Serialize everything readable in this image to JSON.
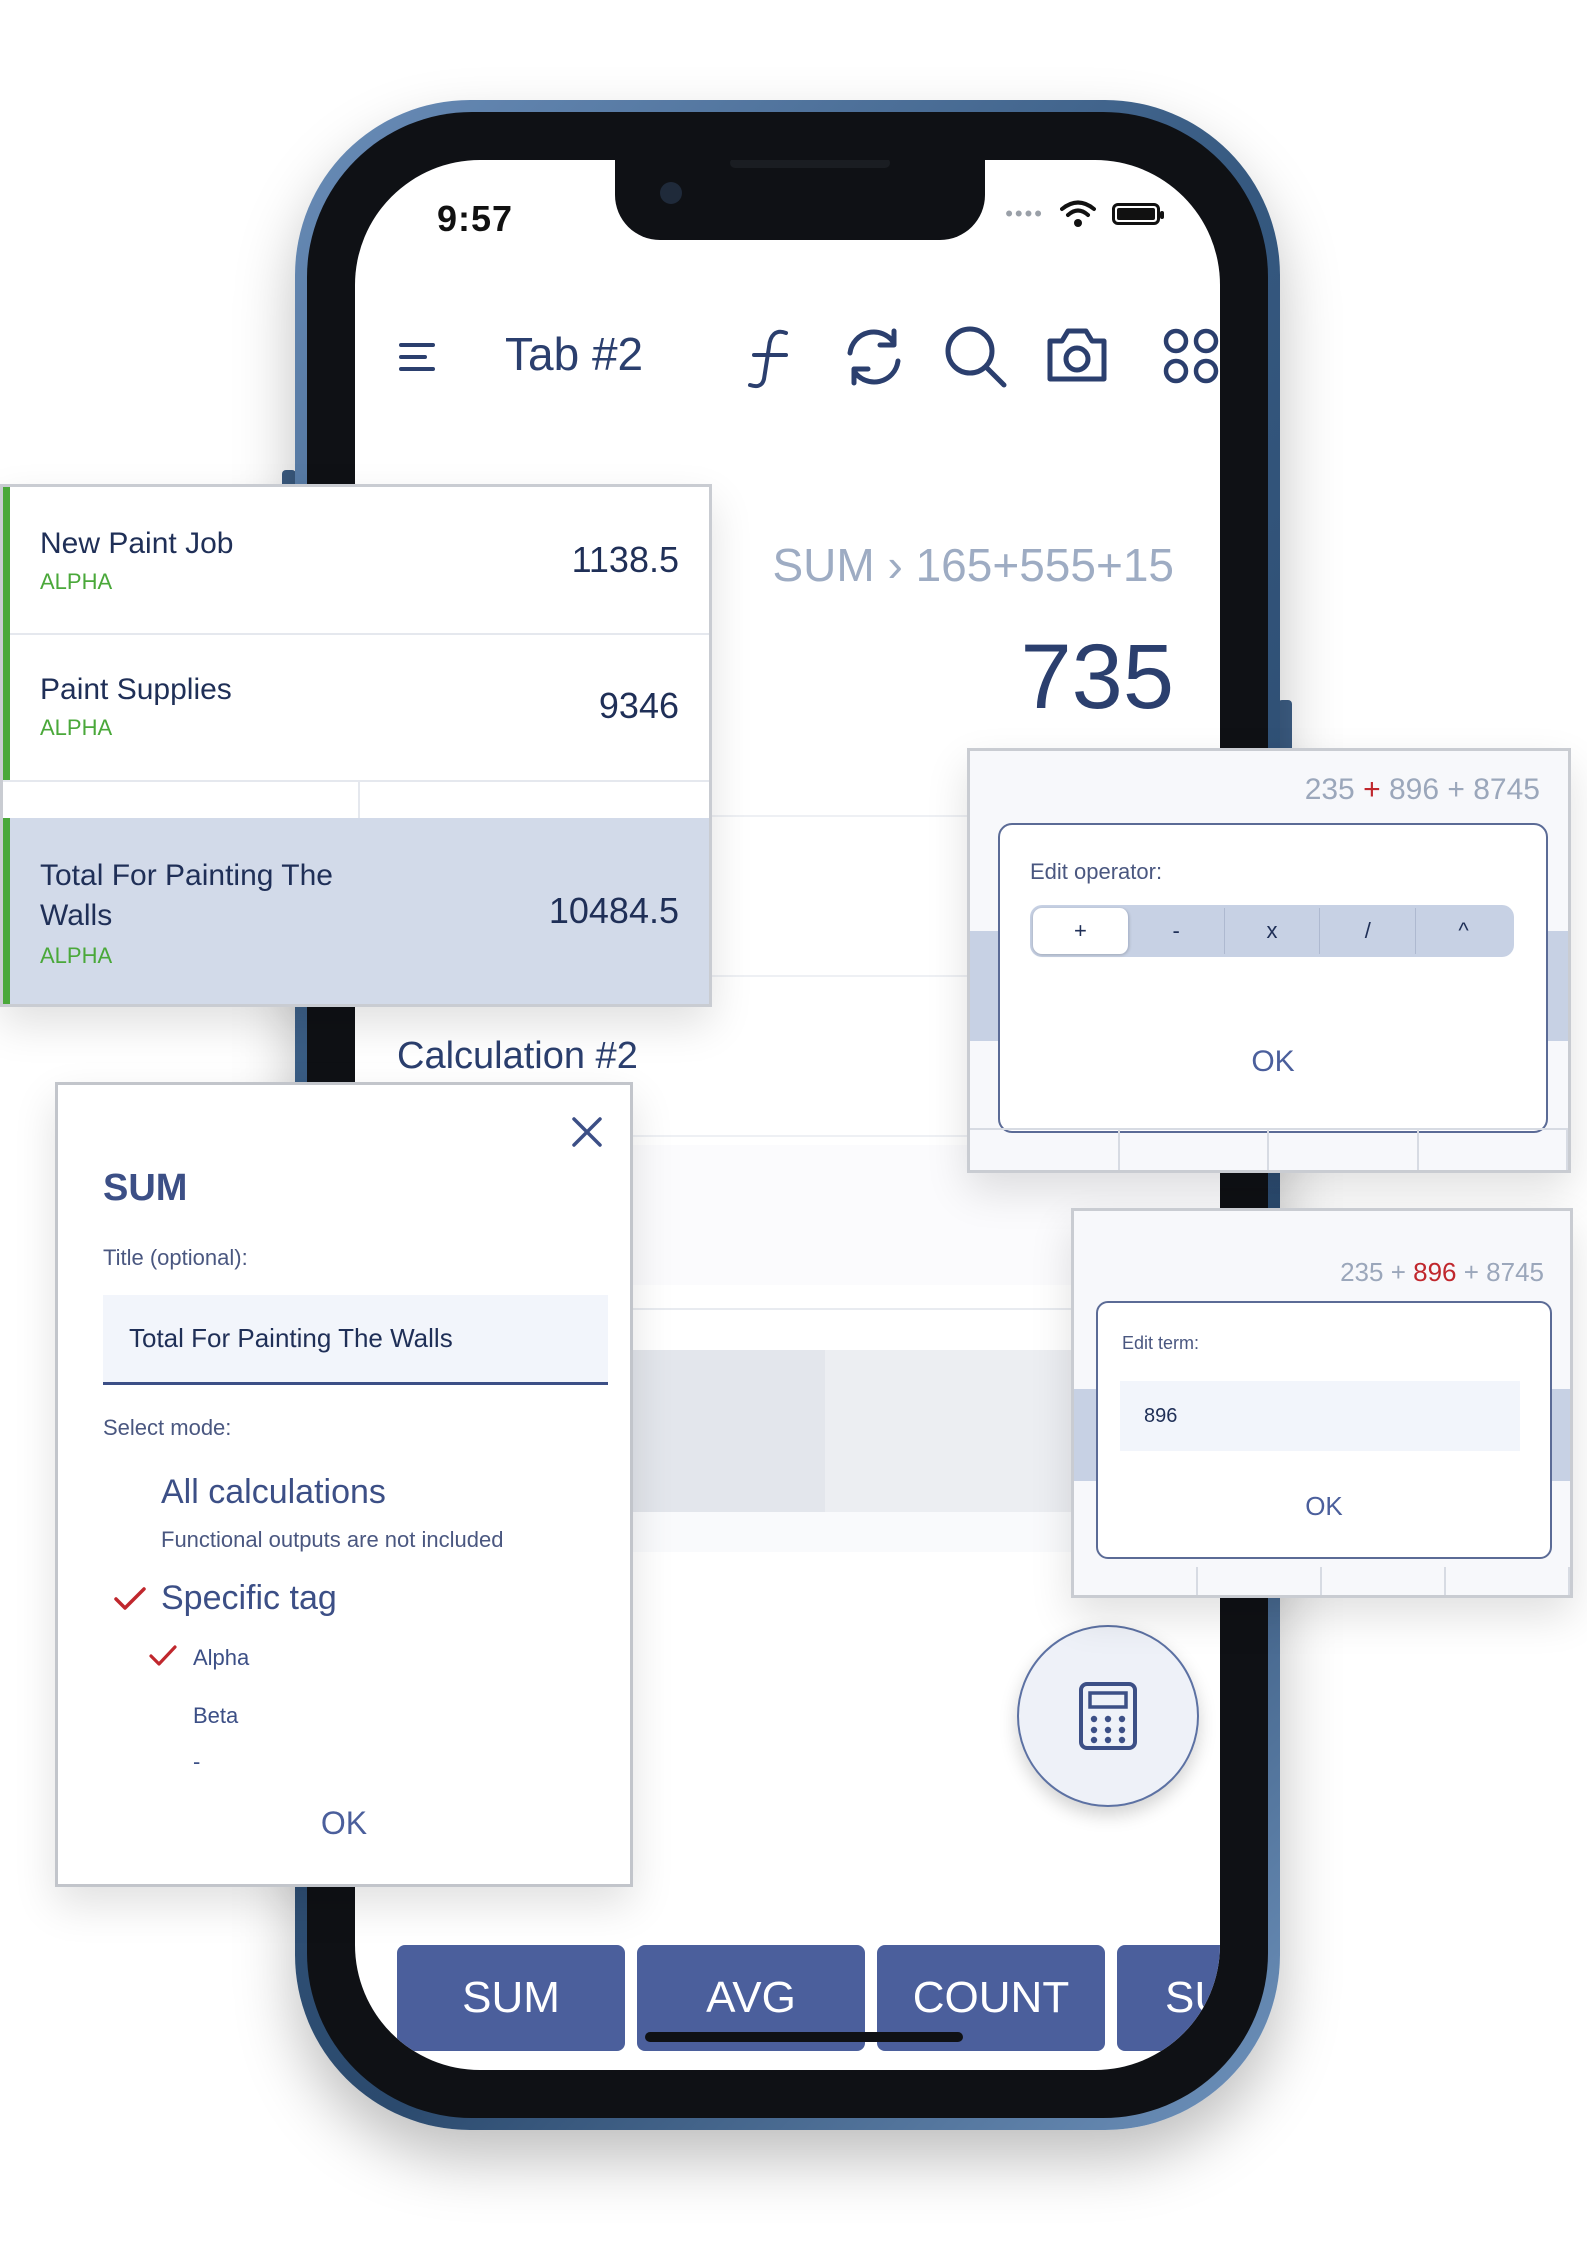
{
  "status": {
    "time": "9:57"
  },
  "toolbar": {
    "tab_title": "Tab #2"
  },
  "calculator": {
    "expression": "SUM › 165+555+15",
    "result": "735",
    "section_title": "Calculation #2"
  },
  "bottom_bar": {
    "sum": "SUM",
    "avg": "AVG",
    "count": "COUNT",
    "sum_cut": "SUN"
  },
  "results_list": [
    {
      "name": "New Paint Job",
      "tag": "ALPHA",
      "value": "1138.5"
    },
    {
      "name": "Paint Supplies",
      "tag": "ALPHA",
      "value": "9346"
    },
    {
      "name": "Total For Painting The Walls",
      "tag": "ALPHA",
      "value": "10484.5"
    }
  ],
  "operator_dialog": {
    "expr_a": "235",
    "expr_op1": "+",
    "expr_b": "896",
    "expr_op2": "+",
    "expr_c": "8745",
    "label": "Edit operator:",
    "options": [
      "+",
      "-",
      "x",
      "/",
      "^"
    ],
    "selected": "+",
    "ok": "OK"
  },
  "term_dialog": {
    "expr_a": "235",
    "expr_op1": "+",
    "expr_b": "896",
    "expr_op2": "+",
    "expr_c": "8745",
    "label": "Edit term:",
    "value": "896",
    "ok": "OK"
  },
  "sum_dialog": {
    "title": "SUM",
    "title_label": "Title (optional):",
    "title_value": "Total For Painting The Walls",
    "mode_label": "Select mode:",
    "option_all": "All calculations",
    "option_all_sub": "Functional outputs are not included",
    "option_tag": "Specific tag",
    "tag_alpha": "Alpha",
    "tag_beta": "Beta",
    "tag_none": "-",
    "ok": "OK"
  },
  "colors": {
    "accent": "#4b5f9c",
    "tag_green": "#4aa83a",
    "check_red": "#c0272d",
    "frame_blue": "#35587f"
  }
}
